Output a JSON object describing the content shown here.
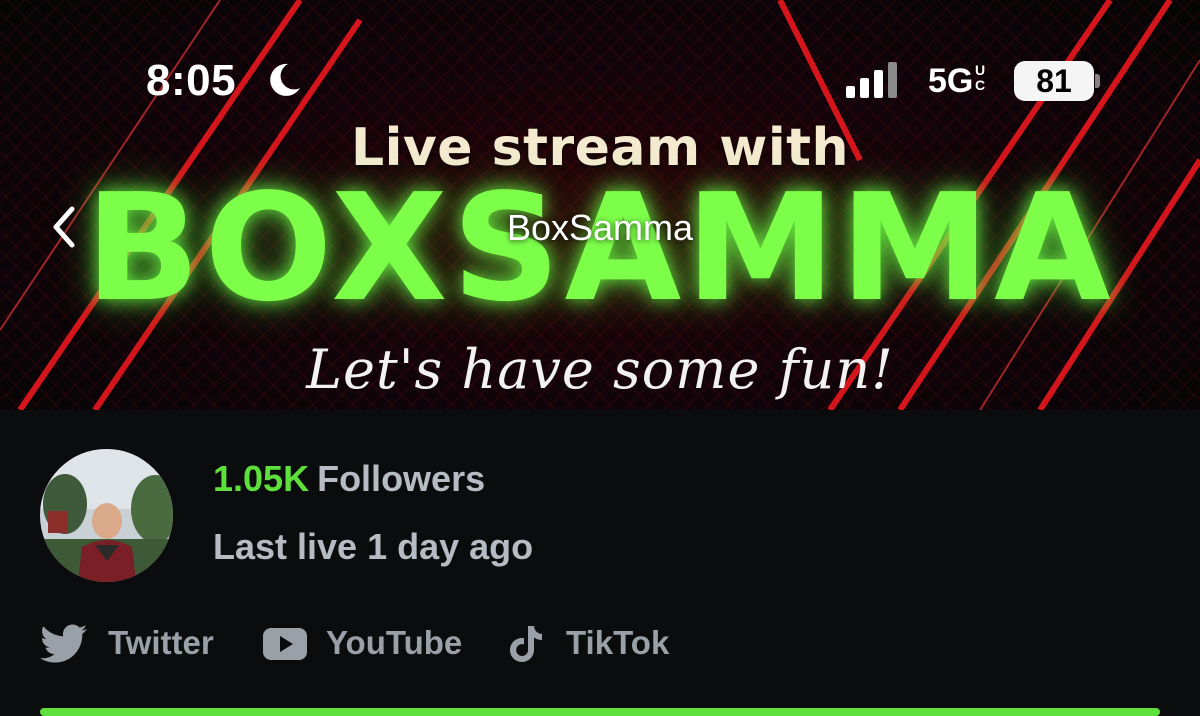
{
  "status_bar": {
    "time": "8:05",
    "network": "5G",
    "network_superscript": "UC",
    "battery": "81"
  },
  "banner": {
    "headline": "Live stream with",
    "big_name": "BOXSAMMA",
    "tagline": "Let's have some fun!",
    "accent_color": "#7dff4a",
    "stripe_color": "#e0161e"
  },
  "nav": {
    "title": "BoxSamma"
  },
  "profile": {
    "followers_count": "1.05K",
    "followers_label": "Followers",
    "last_live": "Last live 1 day ago",
    "count_color": "#5ee03c"
  },
  "socials": [
    {
      "label": "Twitter",
      "icon": "twitter-icon"
    },
    {
      "label": "YouTube",
      "icon": "youtube-icon"
    },
    {
      "label": "TikTok",
      "icon": "tiktok-icon"
    }
  ]
}
